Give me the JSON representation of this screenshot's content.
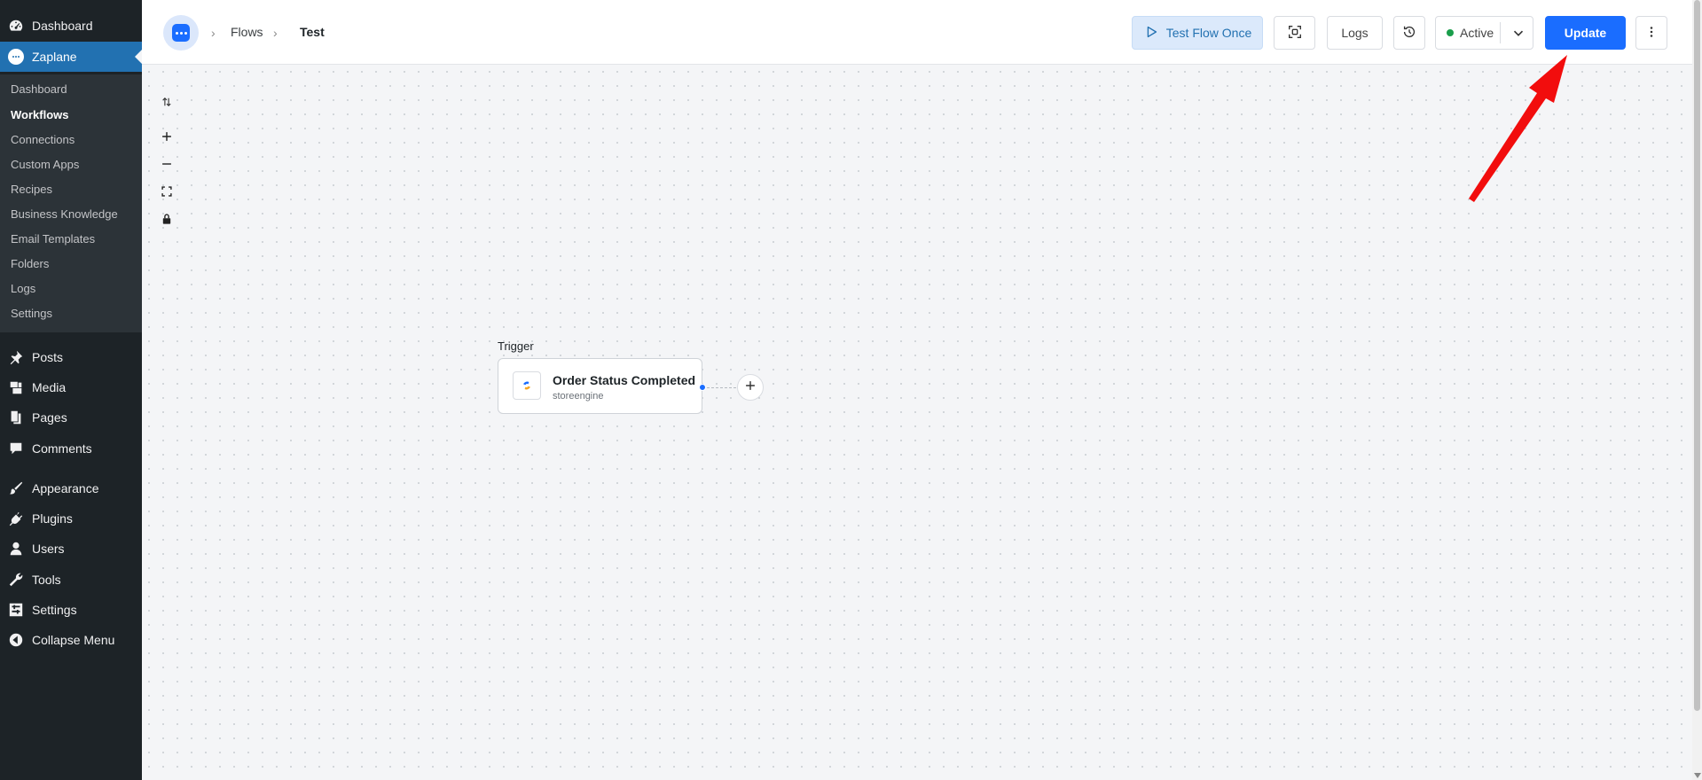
{
  "wp_menu": {
    "dashboard": "Dashboard",
    "zaplane": "Zaplane",
    "submenu": [
      "Dashboard",
      "Workflows",
      "Connections",
      "Custom Apps",
      "Recipes",
      "Business Knowledge",
      "Email Templates",
      "Folders",
      "Logs",
      "Settings"
    ],
    "posts": "Posts",
    "media": "Media",
    "pages": "Pages",
    "comments": "Comments",
    "appearance": "Appearance",
    "plugins": "Plugins",
    "users": "Users",
    "tools": "Tools",
    "settings": "Settings",
    "collapse": "Collapse Menu"
  },
  "header": {
    "breadcrumb": [
      "Flows",
      "Test"
    ],
    "test_flow_label": "Test Flow Once",
    "logs_label": "Logs",
    "status_label": "Active",
    "update_label": "Update"
  },
  "canvas": {
    "trigger_label": "Trigger",
    "node": {
      "title": "Order Status Completed",
      "subtitle": "storeengine"
    }
  },
  "colors": {
    "accent": "#1a6dff",
    "sidebar_bg": "#1d2327",
    "sidebar_active": "#2271b1",
    "status_active": "#1a9e4b",
    "annotation": "#f20d0d"
  }
}
